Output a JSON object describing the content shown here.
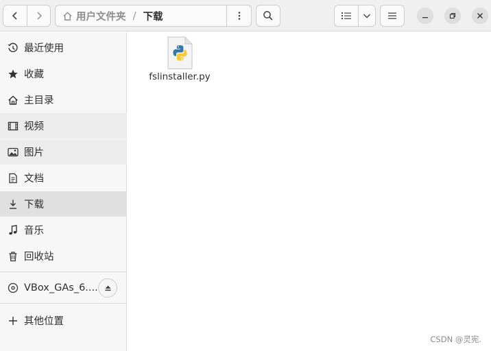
{
  "header": {
    "path": {
      "home_label": "用户文件夹",
      "separator": "/",
      "current": "下载"
    }
  },
  "sidebar": {
    "items": [
      {
        "label": "最近使用",
        "icon": "clock-icon"
      },
      {
        "label": "收藏",
        "icon": "star-icon"
      },
      {
        "label": "主目录",
        "icon": "home-icon"
      },
      {
        "label": "视频",
        "icon": "film-icon"
      },
      {
        "label": "图片",
        "icon": "image-icon"
      },
      {
        "label": "文档",
        "icon": "document-icon"
      },
      {
        "label": "下载",
        "icon": "download-icon",
        "active": true
      },
      {
        "label": "音乐",
        "icon": "music-icon"
      },
      {
        "label": "回收站",
        "icon": "trash-icon"
      }
    ],
    "device": {
      "label": "VBox_GAs_6....",
      "icon": "disc-icon"
    },
    "other": {
      "label": "其他位置",
      "icon": "plus-icon"
    }
  },
  "files": [
    {
      "name": "fslinstaller.py",
      "icon": "python-file-icon"
    }
  ],
  "watermark": "CSDN @灵宪.",
  "colors": {
    "python_blue": "#3a76a8",
    "python_yellow": "#f7cc3c",
    "active_row": "#e0e0e0"
  }
}
